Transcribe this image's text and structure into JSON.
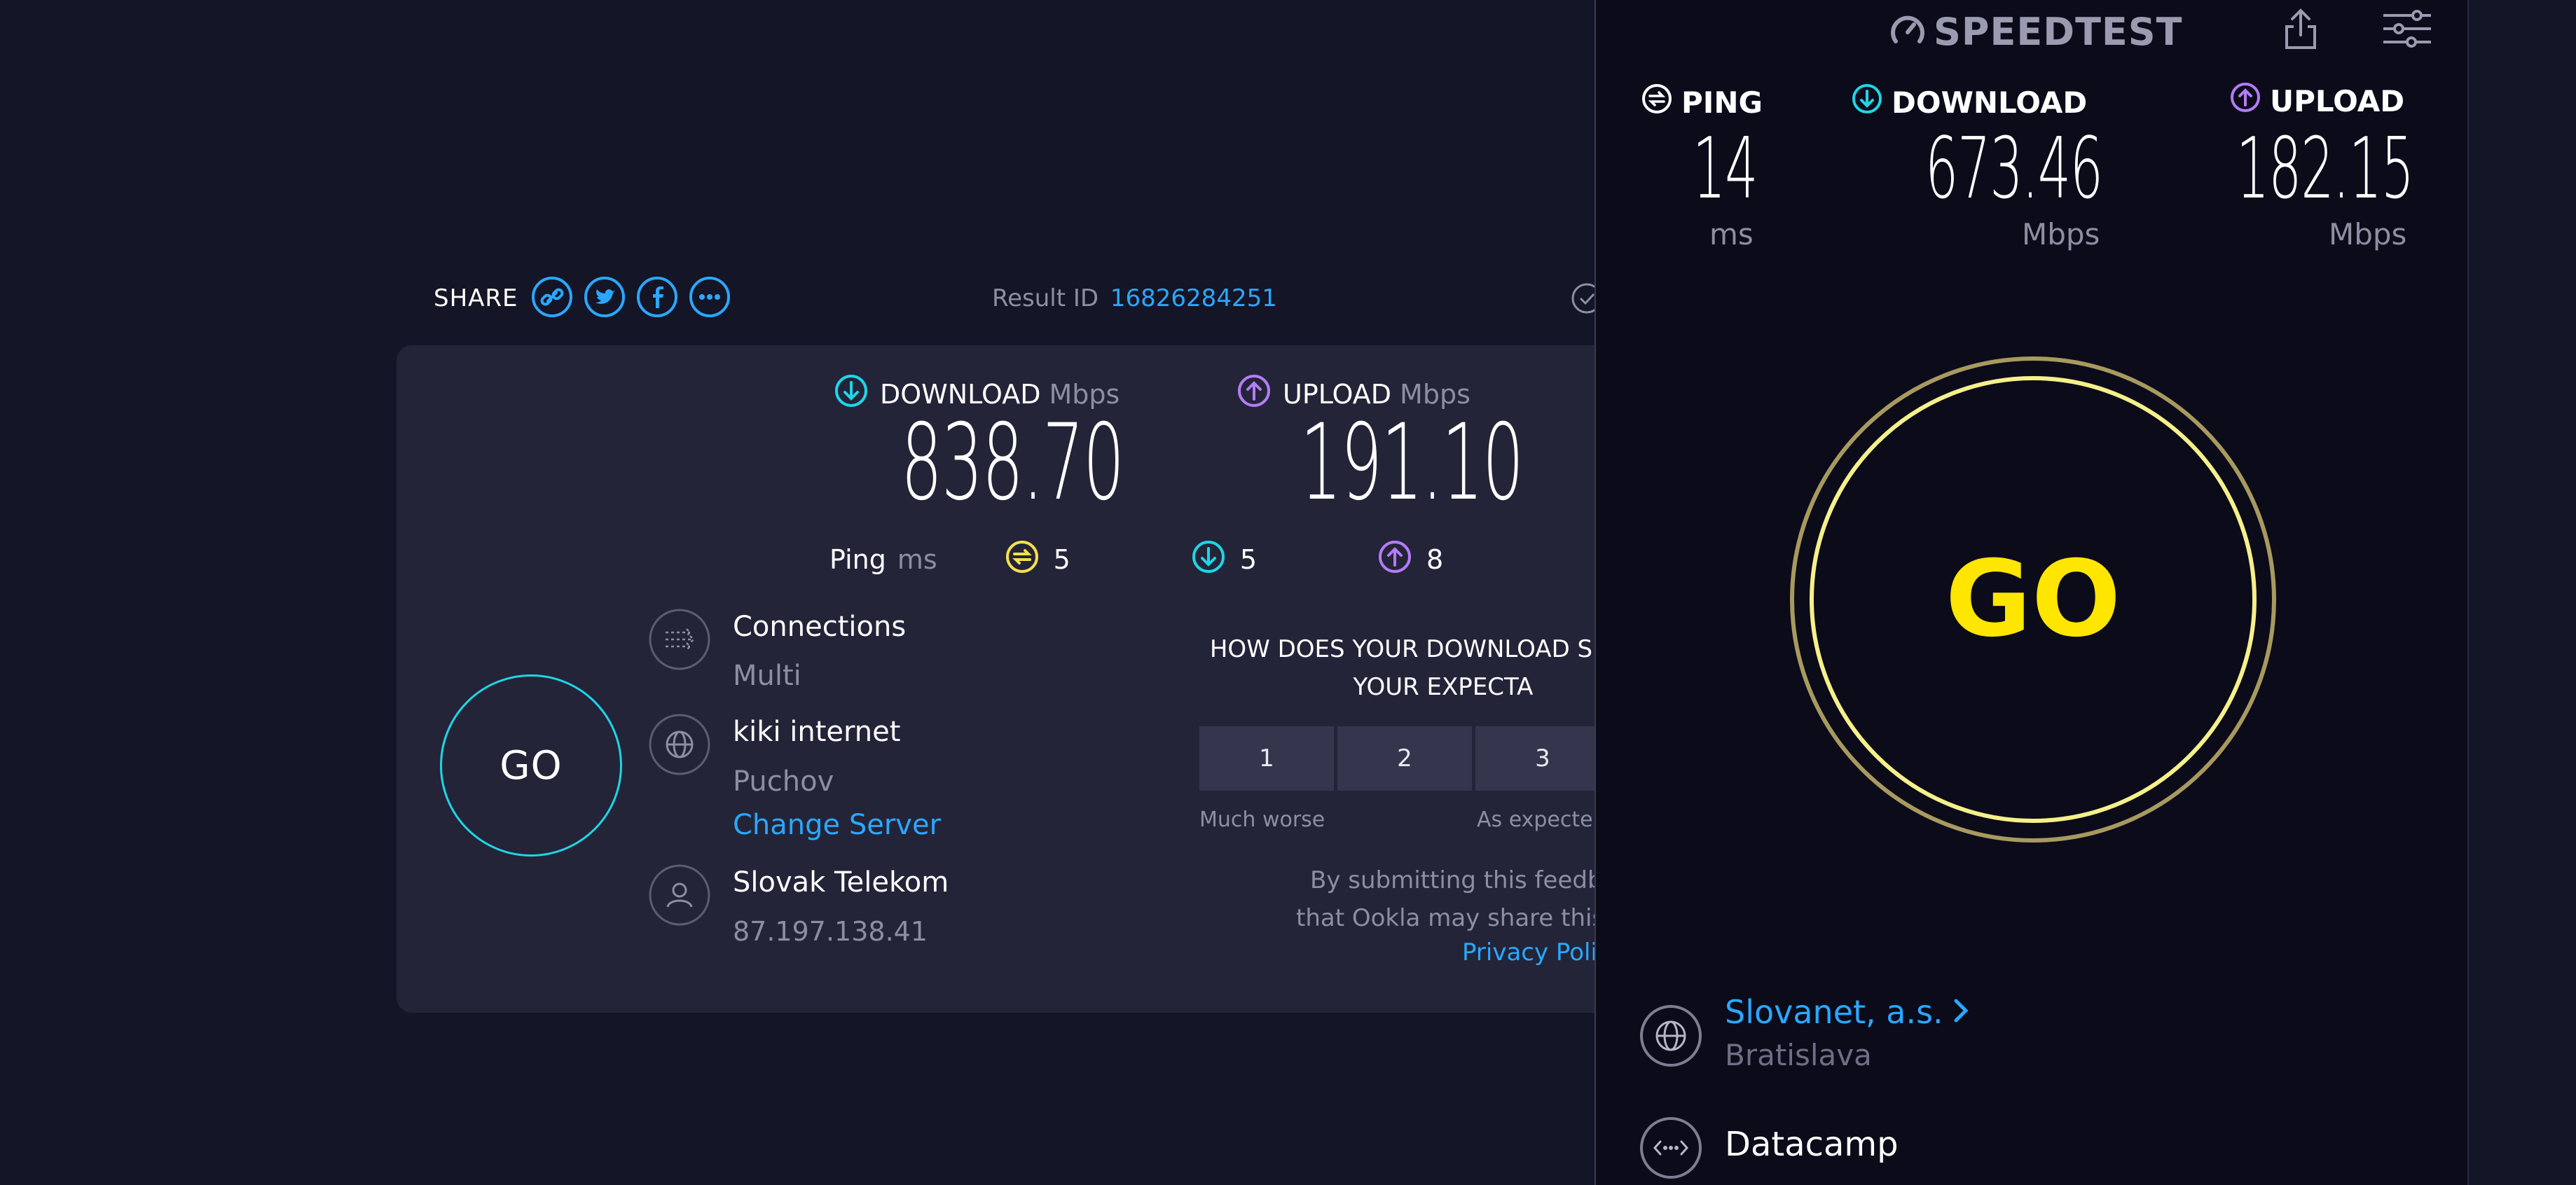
{
  "web": {
    "share_label": "SHARE",
    "result_id_label": "Result ID",
    "result_id": "16826284251",
    "download_label": "DOWNLOAD",
    "download_unit": "Mbps",
    "download_value": "838.70",
    "upload_label": "UPLOAD",
    "upload_unit": "Mbps",
    "upload_value": "191.10",
    "ping_label": "Ping",
    "ping_unit": "ms",
    "ping_idle": "5",
    "ping_download": "5",
    "ping_upload": "8",
    "go_label": "GO",
    "connections_label": "Connections",
    "connections_value": "Multi",
    "server_name": "kiki internet",
    "server_location": "Puchov",
    "change_server": "Change Server",
    "isp_name": "Slovak Telekom",
    "isp_ip": "87.197.138.41",
    "feedback_line1": "HOW DOES YOUR DOWNLOAD S",
    "feedback_line2": "YOUR EXPECTA",
    "ratings": [
      "1",
      "2",
      "3"
    ],
    "rating_low": "Much worse",
    "rating_mid": "As expecte",
    "disclaimer_line1": "By submitting this feedback, you",
    "disclaimer_line2": "that Ookla may share this inform",
    "privacy_link": "Privacy Poli"
  },
  "mobile": {
    "brand": "SPEEDTEST",
    "ping_label": "PING",
    "ping_value": "14",
    "ping_unit": "ms",
    "download_label": "DOWNLOAD",
    "download_value": "673.46",
    "download_unit": "Mbps",
    "upload_label": "UPLOAD",
    "upload_value": "182.15",
    "upload_unit": "Mbps",
    "go_label": "GO",
    "server_name": "Slovanet, a.s.",
    "server_location": "Bratislava",
    "connection_name": "Datacamp"
  },
  "colors": {
    "background": "#141526",
    "card": "#232438",
    "accent_cyan": "#1ed6e6",
    "accent_purple": "#b37cf5",
    "accent_yellow": "#f4e04d",
    "link_blue": "#2aa8ff",
    "go_yellow": "#ffe600"
  }
}
